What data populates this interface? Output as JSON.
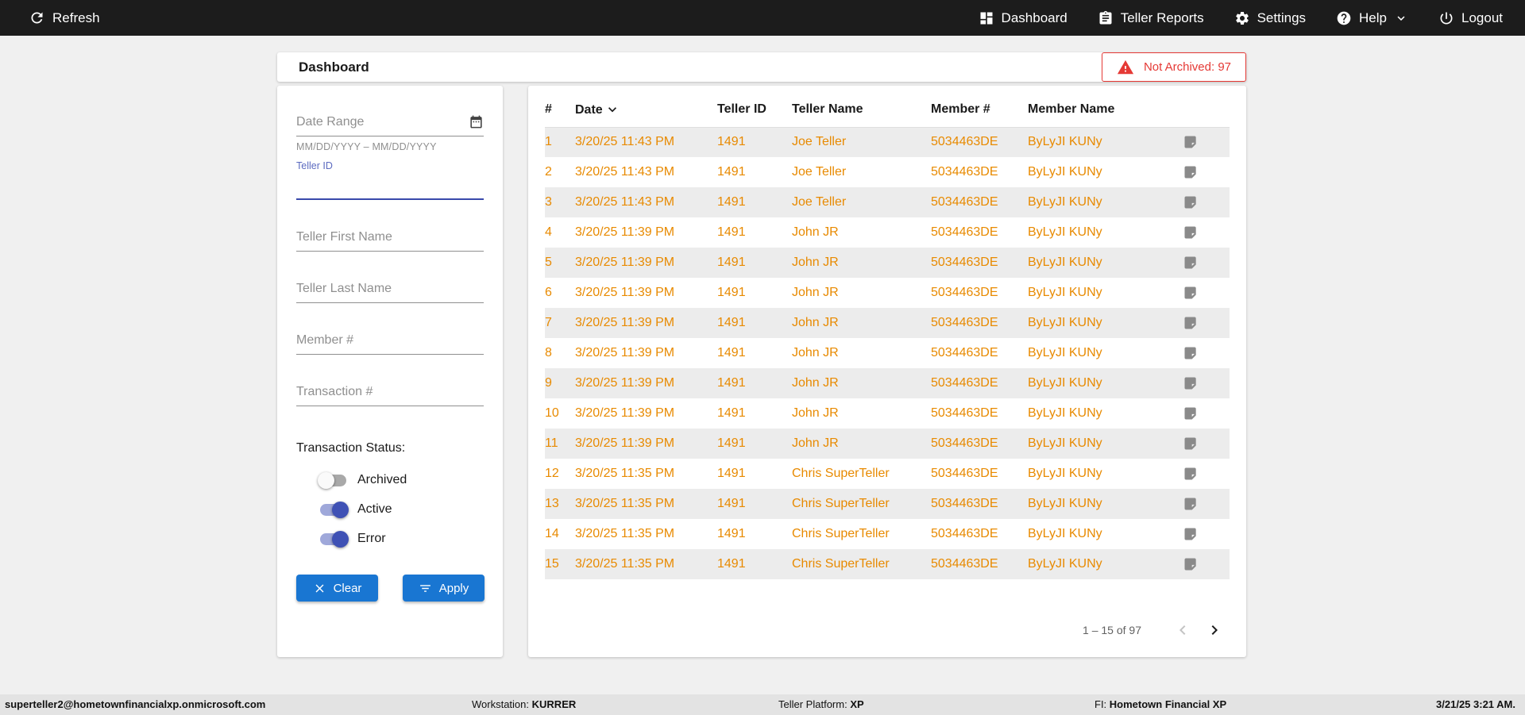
{
  "navbar": {
    "refresh_label": "Refresh",
    "items": [
      {
        "label": "Dashboard",
        "icon": "dashboard-grid"
      },
      {
        "label": "Teller Reports",
        "icon": "clipboard"
      },
      {
        "label": "Settings",
        "icon": "gear"
      },
      {
        "label": "Help",
        "icon": "question-circle",
        "has_chevron": true
      },
      {
        "label": "Logout",
        "icon": "power"
      }
    ]
  },
  "header": {
    "title": "Dashboard",
    "not_archived_badge": "Not Archived: 97"
  },
  "filters": {
    "date_range": {
      "placeholder": "Date Range",
      "helper": "MM/DD/YYYY – MM/DD/YYYY"
    },
    "teller_id": {
      "label": "Teller ID",
      "value": ""
    },
    "teller_first_name": {
      "placeholder": "Teller First Name"
    },
    "teller_last_name": {
      "placeholder": "Teller Last Name"
    },
    "member_number": {
      "placeholder": "Member #"
    },
    "transaction_number": {
      "placeholder": "Transaction #"
    },
    "status_label": "Transaction Status:",
    "toggles": [
      {
        "label": "Archived",
        "on": false
      },
      {
        "label": "Active",
        "on": true
      },
      {
        "label": "Error",
        "on": true
      }
    ],
    "clear_label": "Clear",
    "apply_label": "Apply"
  },
  "table": {
    "columns": [
      "#",
      "Date",
      "Teller ID",
      "Teller Name",
      "Member #",
      "Member Name"
    ],
    "sort_column": "Date",
    "sort_direction": "desc",
    "rows": [
      {
        "num": "1",
        "date": "3/20/25 11:43 PM",
        "teller_id": "1491",
        "teller_name": "Joe Teller",
        "member_num": "5034463DE",
        "member_name": "ByLyJI KUNy"
      },
      {
        "num": "2",
        "date": "3/20/25 11:43 PM",
        "teller_id": "1491",
        "teller_name": "Joe Teller",
        "member_num": "5034463DE",
        "member_name": "ByLyJI KUNy"
      },
      {
        "num": "3",
        "date": "3/20/25 11:43 PM",
        "teller_id": "1491",
        "teller_name": "Joe Teller",
        "member_num": "5034463DE",
        "member_name": "ByLyJI KUNy"
      },
      {
        "num": "4",
        "date": "3/20/25 11:39 PM",
        "teller_id": "1491",
        "teller_name": "John JR",
        "member_num": "5034463DE",
        "member_name": "ByLyJI KUNy"
      },
      {
        "num": "5",
        "date": "3/20/25 11:39 PM",
        "teller_id": "1491",
        "teller_name": "John JR",
        "member_num": "5034463DE",
        "member_name": "ByLyJI KUNy"
      },
      {
        "num": "6",
        "date": "3/20/25 11:39 PM",
        "teller_id": "1491",
        "teller_name": "John JR",
        "member_num": "5034463DE",
        "member_name": "ByLyJI KUNy"
      },
      {
        "num": "7",
        "date": "3/20/25 11:39 PM",
        "teller_id": "1491",
        "teller_name": "John JR",
        "member_num": "5034463DE",
        "member_name": "ByLyJI KUNy"
      },
      {
        "num": "8",
        "date": "3/20/25 11:39 PM",
        "teller_id": "1491",
        "teller_name": "John JR",
        "member_num": "5034463DE",
        "member_name": "ByLyJI KUNy"
      },
      {
        "num": "9",
        "date": "3/20/25 11:39 PM",
        "teller_id": "1491",
        "teller_name": "John JR",
        "member_num": "5034463DE",
        "member_name": "ByLyJI KUNy"
      },
      {
        "num": "10",
        "date": "3/20/25 11:39 PM",
        "teller_id": "1491",
        "teller_name": "John JR",
        "member_num": "5034463DE",
        "member_name": "ByLyJI KUNy"
      },
      {
        "num": "11",
        "date": "3/20/25 11:39 PM",
        "teller_id": "1491",
        "teller_name": "John JR",
        "member_num": "5034463DE",
        "member_name": "ByLyJI KUNy"
      },
      {
        "num": "12",
        "date": "3/20/25 11:35 PM",
        "teller_id": "1491",
        "teller_name": "Chris SuperTeller",
        "member_num": "5034463DE",
        "member_name": "ByLyJI KUNy"
      },
      {
        "num": "13",
        "date": "3/20/25 11:35 PM",
        "teller_id": "1491",
        "teller_name": "Chris SuperTeller",
        "member_num": "5034463DE",
        "member_name": "ByLyJI KUNy"
      },
      {
        "num": "14",
        "date": "3/20/25 11:35 PM",
        "teller_id": "1491",
        "teller_name": "Chris SuperTeller",
        "member_num": "5034463DE",
        "member_name": "ByLyJI KUNy"
      },
      {
        "num": "15",
        "date": "3/20/25 11:35 PM",
        "teller_id": "1491",
        "teller_name": "Chris SuperTeller",
        "member_num": "5034463DE",
        "member_name": "ByLyJI KUNy"
      }
    ],
    "pagination": {
      "range_label": "1 – 15 of 97"
    }
  },
  "footer": {
    "user": "superteller2@hometownfinancialxp.onmicrosoft.com",
    "workstation_label": "Workstation:",
    "workstation_value": "KURRER",
    "platform_label": "Teller Platform:",
    "platform_value": "XP",
    "fi_label": "FI:",
    "fi_value": "Hometown Financial XP",
    "datetime": "3/21/25 3:21 AM."
  },
  "colors": {
    "navbar_bg": "#1c1c1c",
    "accent_blue": "#1976d2",
    "toggle_blue": "#3f51b5",
    "row_text_orange": "#e88a00",
    "alert_red": "#e53935"
  },
  "icons": {
    "refresh": "circular-arrow",
    "dashboard": "grid-squares",
    "teller_reports": "clipboard",
    "settings": "gear",
    "help": "question-circle",
    "logout": "power",
    "date_range": "calendar",
    "clear": "x-cross",
    "apply": "filter-lines",
    "row_note": "note",
    "sort": "chevron-down",
    "prev_page": "chevron-left",
    "next_page": "chevron-right",
    "alert": "warning-triangle"
  }
}
